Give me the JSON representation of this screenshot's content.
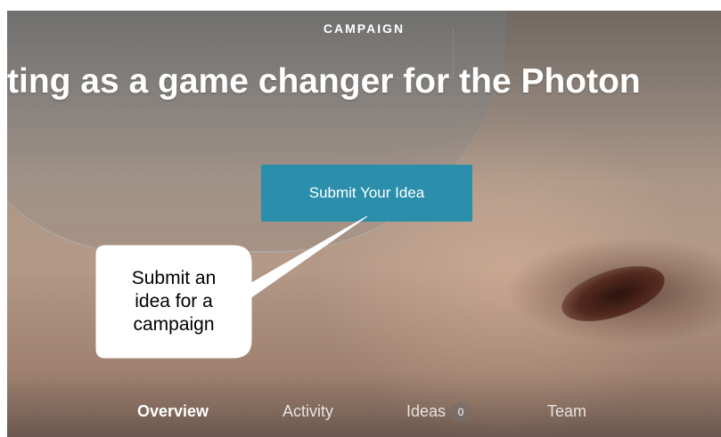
{
  "hero": {
    "section_label": "CAMPAIGN",
    "headline": "ting as a game changer for the Photon",
    "primary_button": "Submit Your Idea"
  },
  "tabs": [
    {
      "label": "Overview",
      "active": true
    },
    {
      "label": "Activity",
      "active": false
    },
    {
      "label": "Ideas",
      "count": "0",
      "active": false
    },
    {
      "label": "Team",
      "active": false
    }
  ],
  "callout": {
    "lines": [
      "Submit an",
      "idea for a",
      "campaign"
    ]
  },
  "colors": {
    "button": "#2b8fab",
    "text": "#ffffff"
  }
}
